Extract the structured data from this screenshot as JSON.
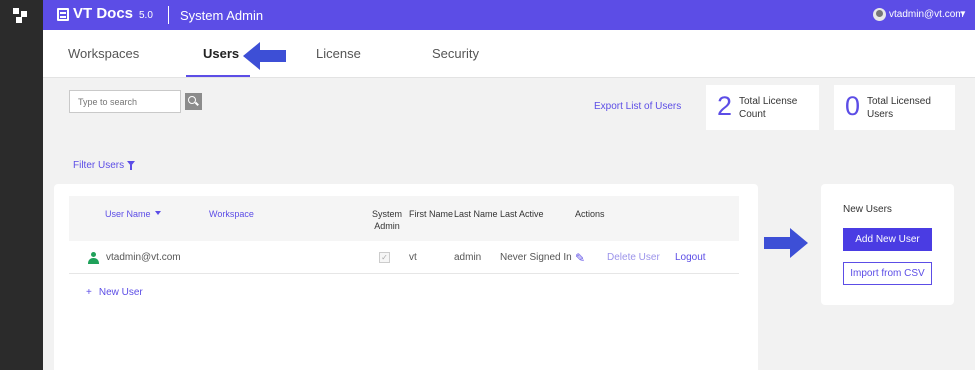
{
  "header": {
    "brand": "VT Docs",
    "version": "5.0",
    "title": "System Admin",
    "user_email": "vtadmin@vt.com",
    "caret": "▼"
  },
  "tabs": [
    {
      "label": "Workspaces",
      "active": false
    },
    {
      "label": "Users",
      "active": true
    },
    {
      "label": "License",
      "active": false
    },
    {
      "label": "Security",
      "active": false
    }
  ],
  "toolbar": {
    "search_placeholder": "Type to search",
    "export_label": "Export List of Users",
    "filter_label": "Filter Users"
  },
  "stats": [
    {
      "value": "2",
      "label": "Total License Count"
    },
    {
      "value": "0",
      "label": "Total Licensed Users"
    }
  ],
  "table": {
    "columns": [
      "User Name",
      "Workspace",
      "System Admin",
      "First Name",
      "Last Name",
      "Last Active",
      "Actions"
    ],
    "rows": [
      {
        "user_name": "vtadmin@vt.com",
        "workspace": "",
        "system_admin": true,
        "checkbox_mark": "✓",
        "first_name": "vt",
        "last_name": "admin",
        "last_active": "Never Signed In",
        "edit_glyph": "✎",
        "delete_label": "Delete User",
        "logout_label": "Logout"
      }
    ],
    "new_user_plus": "+",
    "new_user_label": "New User"
  },
  "side_panel": {
    "title": "New Users",
    "add_button": "Add New User",
    "import_button": "Import from CSV"
  },
  "colors": {
    "accent": "#5c4de6",
    "sidebar": "#2b2b2b",
    "user_status": "#1fa15a",
    "annotation_arrow": "#3d4fd6"
  }
}
